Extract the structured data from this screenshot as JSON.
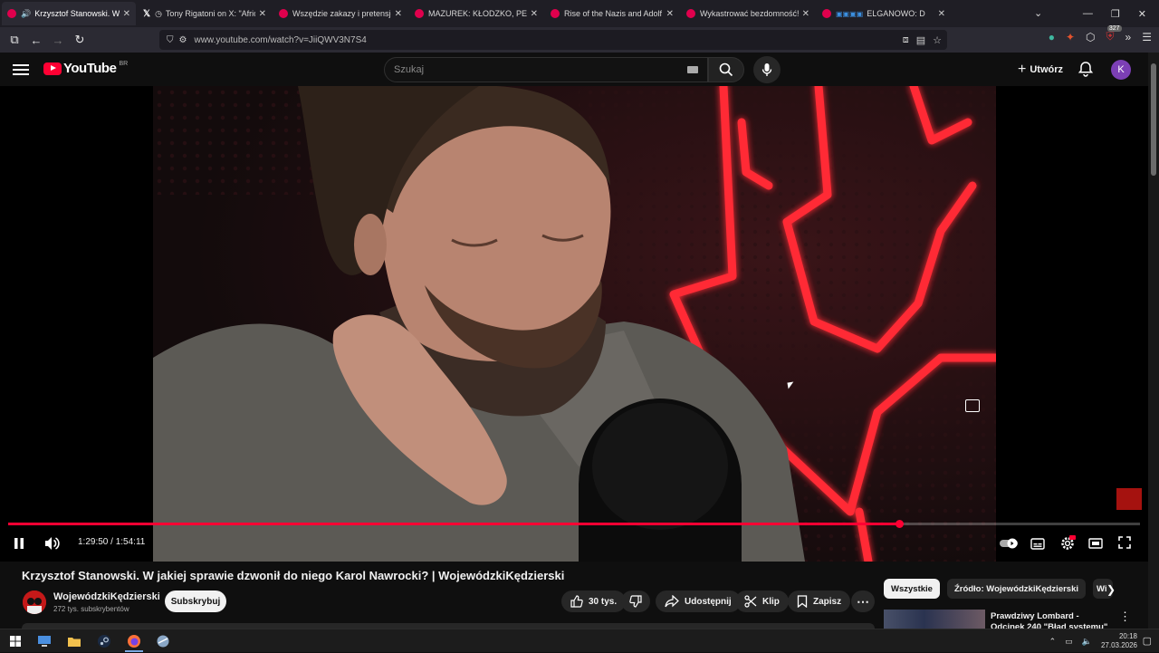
{
  "browser": {
    "tabs": [
      {
        "title": "Krzysztof Stanowski. W jakiej sprawie",
        "favicon": "youtube-icon",
        "active": true,
        "playing": true
      },
      {
        "title": "Tony Rigatoni on X: \"African",
        "favicon": "x-icon",
        "active": false
      },
      {
        "title": "Wszędzie zakazy i pretensje! Lu",
        "favicon": "youtube-icon",
        "active": false
      },
      {
        "title": "MAZUREK: KŁODZKO, PEDOFILI",
        "favicon": "youtube-icon",
        "active": false
      },
      {
        "title": "Rise of the Nazis and Adolf Hitl",
        "favicon": "youtube-icon",
        "active": false
      },
      {
        "title": "Wykastrować bezdomność! Ust",
        "favicon": "youtube-icon",
        "active": false
      },
      {
        "title": "ELGANOWO: D",
        "favicon": "youtube-icon",
        "active": false
      }
    ],
    "url": "www.youtube.com/watch?v=JiiQWV3N7S4",
    "extension_badge": "327"
  },
  "youtube": {
    "logo_text": "YouTube",
    "country_code": "BR",
    "search_placeholder": "Szukaj",
    "create_label": "Utwórz",
    "avatar_letter": "K",
    "avatar_color": "#7c3fb5",
    "accent_color": "#ff0033"
  },
  "player": {
    "current_time": "1:29:50",
    "time_separator": "/",
    "duration": "1:54:11",
    "progress_fraction": 0.787,
    "autoplay_on": true
  },
  "video": {
    "title": "Krzysztof Stanowski. W jakiej sprawie dzwonił do niego Karol Nawrocki? | WojewódzkiKędzierski",
    "channel": "WojewódzkiKędzierski",
    "subscribers": "272 tys. subskrybentów",
    "subscribe_label": "Subskrybuj",
    "likes": "30 tys.",
    "share_label": "Udostępnij",
    "clip_label": "Klip",
    "save_label": "Zapisz"
  },
  "sidebar": {
    "chips": [
      "Wszystkie",
      "Źródło: WojewódzkiKędzierski",
      "Wi"
    ],
    "recommendation": {
      "title": "Prawdziwy Lombard - Odcinek 240 \"Błąd systemu\""
    }
  },
  "taskbar": {
    "time": "20:18",
    "date": "27.03.2026"
  }
}
